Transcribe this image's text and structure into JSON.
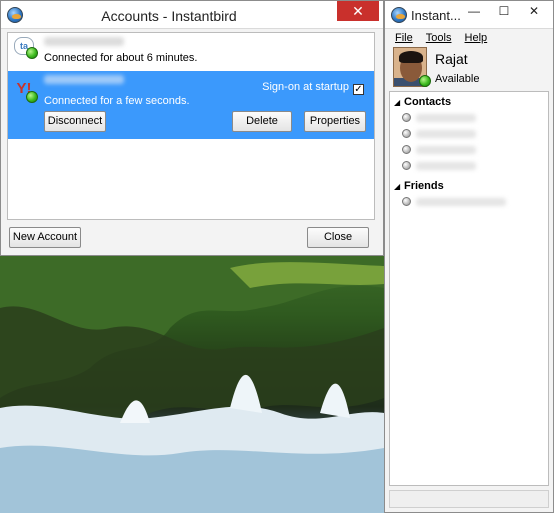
{
  "accounts_window": {
    "title": "Accounts - Instantbird",
    "close_glyph": "✕",
    "accounts": [
      {
        "protocol_icon": "gtalk-icon",
        "status_icon": "online-icon",
        "status_text": "Connected for about 6 minutes."
      },
      {
        "protocol_icon": "yahoo-icon",
        "status_icon": "online-icon",
        "status_text": "Connected for a few seconds.",
        "signon_label": "Sign-on at startup",
        "signon_checked": "✓",
        "buttons": {
          "disconnect": "Disconnect",
          "delete": "Delete",
          "properties": "Properties"
        }
      }
    ],
    "new_account_label": "New Account",
    "close_label": "Close"
  },
  "buddy_window": {
    "title": "Instant...",
    "controls": {
      "minimize": "—",
      "maximize": "☐",
      "close": "✕"
    },
    "menu": [
      {
        "label": "File"
      },
      {
        "label": "Tools"
      },
      {
        "label": "Help"
      }
    ],
    "user": {
      "name": "Rajat",
      "presence": "Available"
    },
    "groups": [
      {
        "name": "Contacts",
        "contacts": 4
      },
      {
        "name": "Friends",
        "contacts": 1
      }
    ]
  },
  "colors": {
    "selection": "#3b99fc",
    "online": "#3cba1e",
    "close_button": "#c9302c"
  }
}
